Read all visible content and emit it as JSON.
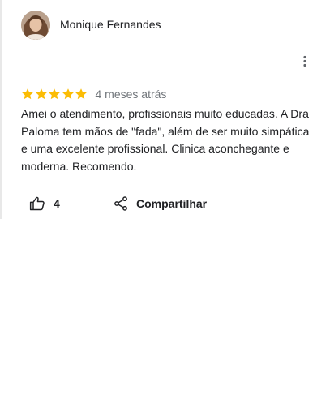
{
  "review": {
    "reviewer_name": "Monique Fernandes",
    "rating": 5,
    "rating_max": 5,
    "date": "4 meses atrás",
    "text": "Amei o atendimento, profissionais muito educadas. A Dra Paloma tem mãos de \"fada\", além de ser muito simpática e uma excelente profissional. Clinica aconchegante e moderna. Recomendo.",
    "likes": "4",
    "share_label": "Compartilhar"
  },
  "icons": {
    "more": "more-vert-icon",
    "star": "star-icon",
    "like": "thumb-up-icon",
    "share": "share-icon"
  },
  "colors": {
    "star": "#fbbc04",
    "text": "#202124",
    "secondary_text": "#70757a",
    "icon": "#5f6368"
  }
}
